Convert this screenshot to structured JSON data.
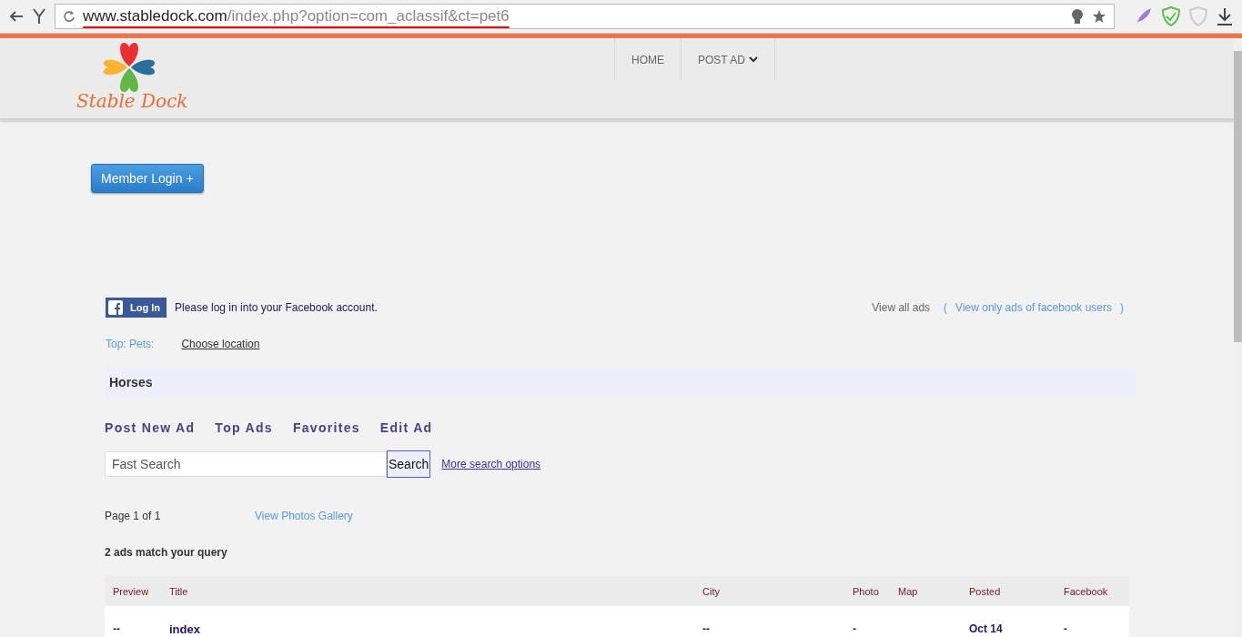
{
  "browser": {
    "url_host": "www.stabledock.com",
    "url_path": "/index.php?option=com_aclassif&ct=pet6",
    "url_underlined": true
  },
  "header": {
    "logo_text": "Stable Dock",
    "nav": [
      {
        "label": "HOME",
        "dropdown": false
      },
      {
        "label": "POST AD",
        "dropdown": true
      }
    ]
  },
  "member_login": "Member Login +",
  "facebook": {
    "button": "Log In",
    "message": "Please log in into your Facebook account.",
    "view_all": "View all ads",
    "view_fb_open": "(",
    "view_fb": "View only ads of facebook users",
    "view_fb_close": ")"
  },
  "breadcrumb": {
    "label": "Top: Pets:",
    "location": "Choose location"
  },
  "category": "Horses",
  "actions": [
    "Post New Ad",
    "Top Ads",
    "Favorites",
    "Edit Ad"
  ],
  "search": {
    "placeholder": "Fast Search",
    "button": "Search",
    "more": "More search options"
  },
  "paging": {
    "text": "Page 1 of 1",
    "gallery": "View Photos Gallery"
  },
  "count": "2 ads match your query",
  "table": {
    "columns": [
      "Preview",
      "Title",
      "City",
      "Photo",
      "Map",
      "Posted",
      "Facebook"
    ],
    "rows": [
      [
        "--",
        "index",
        "--",
        "-",
        null,
        "Oct 14",
        "-"
      ]
    ]
  }
}
